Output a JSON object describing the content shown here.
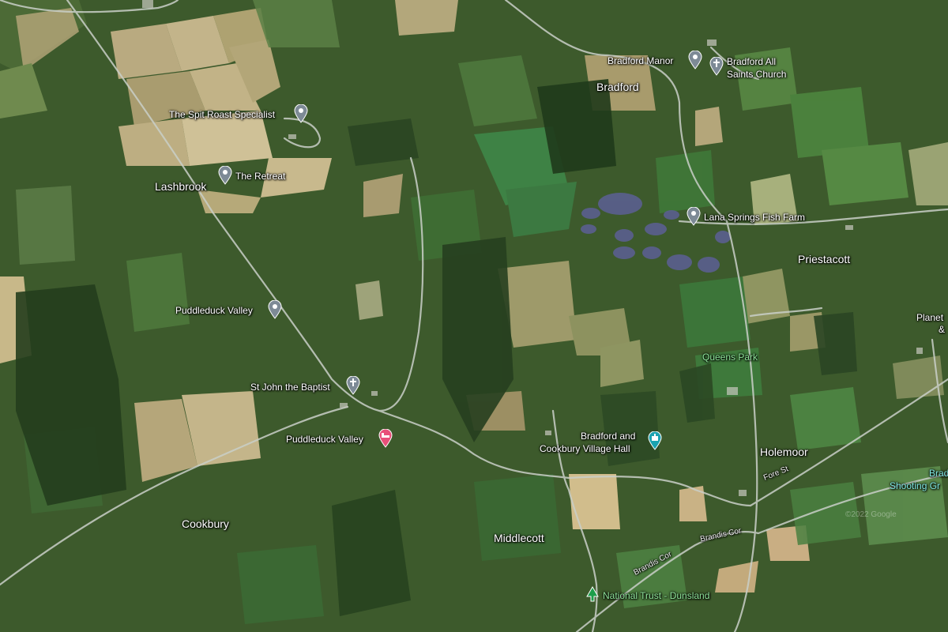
{
  "map": {
    "view": "satellite",
    "watermark": "©2022 Google",
    "places": {
      "bradford": "Bradford",
      "lashbrook": "Lashbrook",
      "priestacott": "Priestacott",
      "holemoor": "Holemoor",
      "cookbury": "Cookbury",
      "middlecott": "Middlecott",
      "planet": "Planet",
      "planet_amp": "&"
    },
    "pois": {
      "bradford_manor": "Bradford Manor",
      "bradford_all_saints_line1": "Bradford All",
      "bradford_all_saints_line2": "Saints Church",
      "spit_roast": "The Spit Roast Specialist",
      "the_retreat": "The Retreat",
      "lana_springs": "Lana Springs Fish Farm",
      "puddleduck_valley_pin": "Puddleduck Valley",
      "st_john": "St John the Baptist",
      "puddleduck_valley_hotel": "Puddleduck Valley",
      "village_hall_line1": "Bradford and",
      "village_hall_line2": "Cookbury Village Hall",
      "queens_park": "Queens Park",
      "national_trust": "National Trust - Dunsland",
      "shooting_line1": "Brad",
      "shooting_line2": "Shooting Gr"
    },
    "roads": {
      "fore_st": "Fore St",
      "brandis_cor_1": "Brandis Cor",
      "brandis_cor_2": "Brandis Cor"
    },
    "colors": {
      "pin_grey": "#7d8a96",
      "pin_hotel": "#e8507a",
      "pin_park": "#1e9e4a",
      "pin_hall": "#1aa3b0",
      "road": "#c9cfc8"
    }
  }
}
